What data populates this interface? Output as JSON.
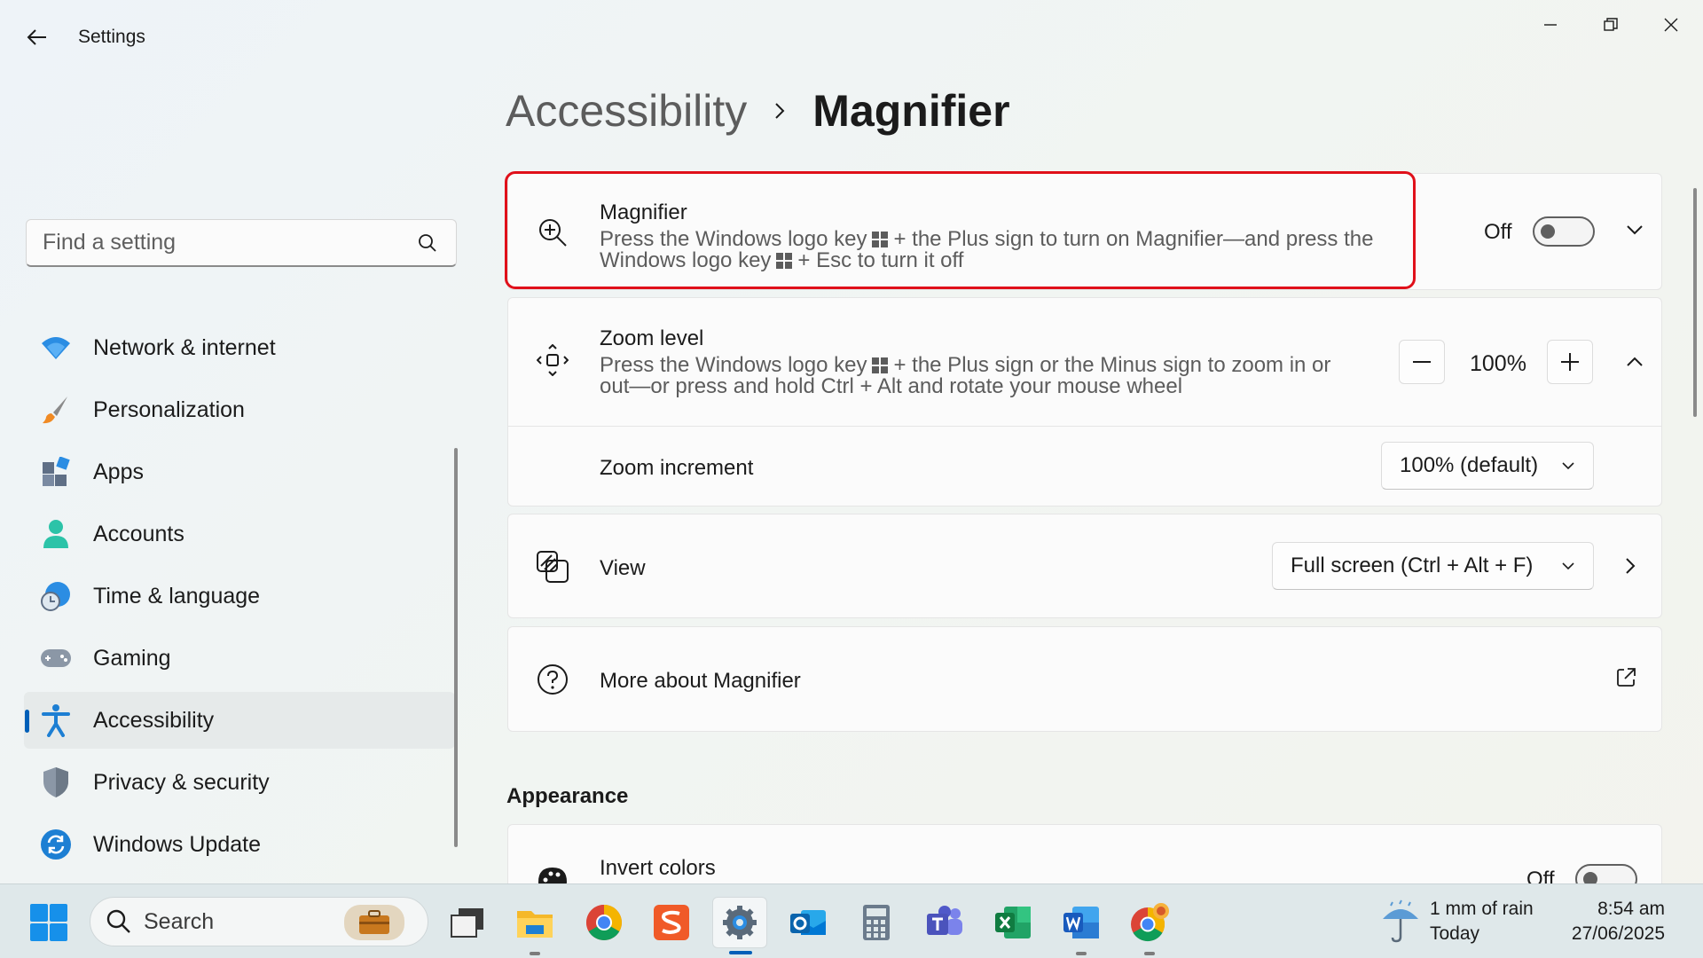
{
  "window": {
    "title": "Settings"
  },
  "search": {
    "placeholder": "Find a setting"
  },
  "sidebar": {
    "items": [
      {
        "label": "Network & internet",
        "icon": "wifi-icon"
      },
      {
        "label": "Personalization",
        "icon": "brush-icon"
      },
      {
        "label": "Apps",
        "icon": "apps-icon"
      },
      {
        "label": "Accounts",
        "icon": "person-icon"
      },
      {
        "label": "Time & language",
        "icon": "globe-clock-icon"
      },
      {
        "label": "Gaming",
        "icon": "gamepad-icon"
      },
      {
        "label": "Accessibility",
        "icon": "accessibility-icon",
        "active": true
      },
      {
        "label": "Privacy & security",
        "icon": "shield-icon"
      },
      {
        "label": "Windows Update",
        "icon": "update-icon"
      }
    ]
  },
  "breadcrumb": {
    "parent": "Accessibility",
    "current": "Magnifier"
  },
  "magnifier": {
    "title": "Magnifier",
    "desc_line1_a": "Press the Windows logo key",
    "desc_line1_b": "+ the Plus sign to turn on Magnifier—and press the",
    "desc_line2_a": "Windows logo key",
    "desc_line2_b": "+ Esc to turn it off",
    "state": "Off",
    "toggle_on": false
  },
  "zoom_level": {
    "title": "Zoom level",
    "desc_line1_a": "Press the Windows logo key",
    "desc_line1_b": "+ the Plus sign or the Minus sign to zoom in or",
    "desc_line2": "out—or press and hold Ctrl + Alt and rotate your mouse wheel",
    "value": "100%",
    "minus": "−",
    "plus": "+"
  },
  "zoom_increment": {
    "title": "Zoom increment",
    "selected": "100% (default)"
  },
  "view": {
    "title": "View",
    "selected": "Full screen (Ctrl + Alt + F)"
  },
  "more_about": {
    "title": "More about Magnifier"
  },
  "appearance": {
    "heading": "Appearance",
    "invert_colors": {
      "title": "Invert colors",
      "state": "Off"
    }
  },
  "taskbar": {
    "search_label": "Search",
    "weather_line1": "1 mm of rain",
    "weather_line2": "Today",
    "time": "8:54 am",
    "date": "27/06/2025",
    "apps": [
      "task-view",
      "file-explorer",
      "chrome",
      "sublime",
      "settings",
      "outlook",
      "calculator",
      "teams",
      "excel",
      "word",
      "chrome-profile"
    ]
  },
  "colors": {
    "accent": "#005fb8",
    "highlight": "#e0101a"
  }
}
